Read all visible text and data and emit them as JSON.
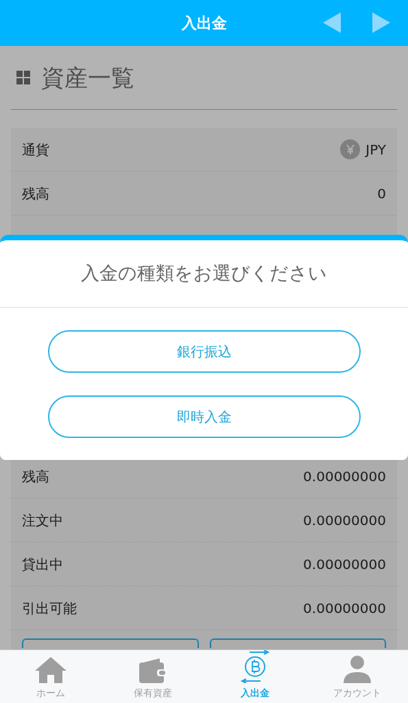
{
  "header": {
    "title": "入出金"
  },
  "section_title": "資産一覧",
  "jpy_rows": [
    {
      "kind": "currency",
      "label": "通貨",
      "value": "JPY"
    },
    {
      "kind": "plain",
      "label": "残高",
      "value": "0"
    }
  ],
  "crypto_rows": [
    {
      "label": "残高",
      "value": "0.00000000"
    },
    {
      "label": "注文中",
      "value": "0.00000000"
    },
    {
      "label": "貸出中",
      "value": "0.00000000"
    },
    {
      "label": "引出可能",
      "value": "0.00000000"
    }
  ],
  "dialog": {
    "title": "入金の種類をお選びください",
    "options": [
      "銀行振込",
      "即時入金"
    ]
  },
  "nav": [
    {
      "kind": "home",
      "label": "ホーム",
      "selected": false
    },
    {
      "kind": "wallet",
      "label": "保有資産",
      "selected": false
    },
    {
      "kind": "exchange",
      "label": "入出金",
      "selected": true
    },
    {
      "kind": "account",
      "label": "アカウント",
      "selected": false
    }
  ]
}
